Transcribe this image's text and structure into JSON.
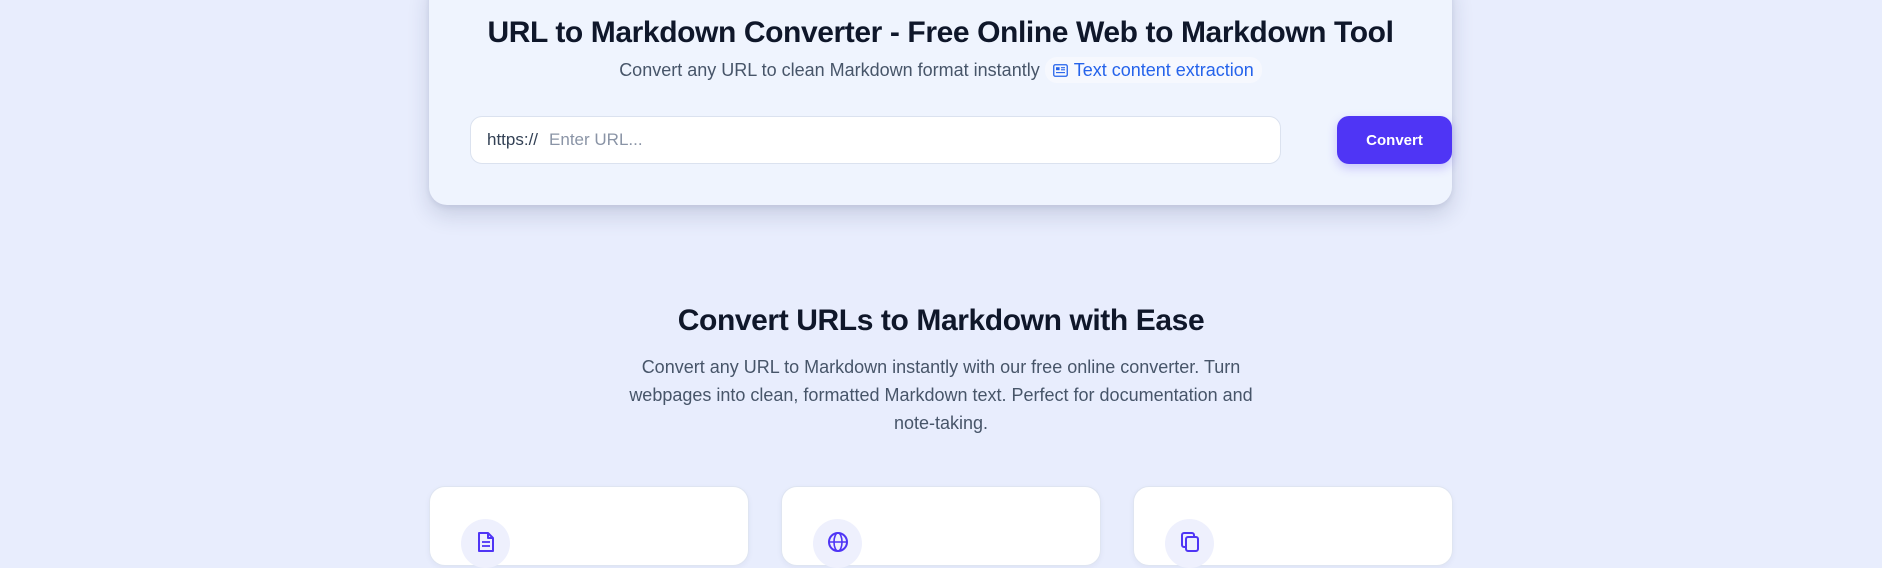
{
  "hero": {
    "title": "URL to Markdown Converter - Free Online Web to Markdown Tool",
    "subtitle": "Convert any URL to clean Markdown format instantly",
    "chip": {
      "icon": "newspaper-icon",
      "label": "Text content extraction"
    }
  },
  "form": {
    "prefix": "https://",
    "input_value": "",
    "placeholder": "Enter URL...",
    "button_label": "Convert"
  },
  "features": {
    "title": "Convert URLs to Markdown with Ease",
    "description": "Convert any URL to Markdown instantly with our free online converter. Turn webpages into clean, formatted Markdown text. Perfect for documentation and note-taking.",
    "cards": [
      {
        "icon": "document-icon"
      },
      {
        "icon": "globe-icon"
      },
      {
        "icon": "copy-icon"
      }
    ]
  },
  "colors": {
    "page_background": "#e8edfd",
    "accent": "#4f35f5",
    "link": "#2563eb",
    "heading": "#0f172a",
    "body_text": "#475569"
  }
}
